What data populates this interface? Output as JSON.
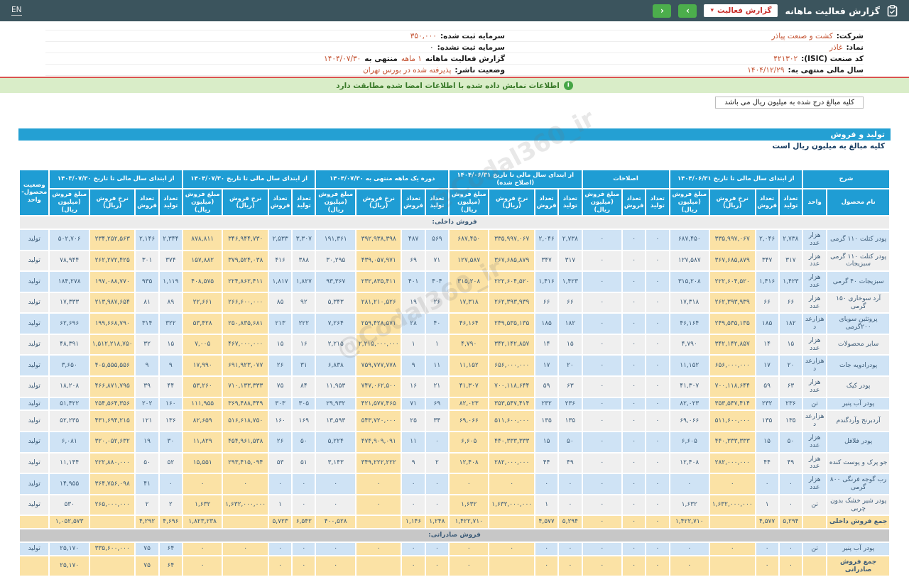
{
  "topbar": {
    "lang": "EN",
    "title": "گزارش فعالیت ماهانه",
    "report_button": "گزارش فعالیت",
    "caret": "▾",
    "nav_next": "›",
    "nav_prev": "‹"
  },
  "info": {
    "rows": [
      {
        "right": [
          [
            "شرکت:",
            "l"
          ],
          [
            "کشت و صنعت پیاذر",
            "v"
          ]
        ],
        "left": [
          [
            "سرمایه ثبت شده:",
            "l"
          ],
          [
            "۳۵۰,۰۰۰",
            "v"
          ]
        ]
      },
      {
        "right": [
          [
            "نماد:",
            "l"
          ],
          [
            "غاذر",
            "v"
          ]
        ],
        "left": [
          [
            "سرمایه ثبت نشده:",
            "l"
          ],
          [
            "۰",
            "d"
          ]
        ]
      },
      {
        "right": [
          [
            "کد صنعت (ISIC):",
            "l"
          ],
          [
            "۴۲۱۳۰۲",
            "v"
          ]
        ],
        "left": [
          [
            "گزارش فعالیت ماهانه",
            "l"
          ],
          [
            "۱ ماهه",
            "v"
          ],
          [
            "منتهی به",
            "l"
          ],
          [
            "۱۴۰۴/۰۷/۳۰",
            "v"
          ]
        ]
      },
      {
        "right": [
          [
            "سال مالی منتهی به:",
            "l"
          ],
          [
            "۱۴۰۴/۱۲/۲۹",
            "v"
          ]
        ],
        "left": [
          [
            "وضعیت ناشر:",
            "l"
          ],
          [
            "پذیرفته شده در بورس تهران",
            "v"
          ]
        ]
      }
    ]
  },
  "notice": {
    "text": "اطلاعات نمایش داده شده با اطلاعات امضا شده مطابقت دارد"
  },
  "amounts_note": "کلیه مبالغ درج شده به میلیون ریال می باشد",
  "section": {
    "title": "تولید و فروش",
    "subtitle": "کلیه مبالغ به میلیون ریال است"
  },
  "watermark": "@Codal360_ir",
  "colors": {
    "topbar": "#3b545d",
    "accent_blue": "#24a0d3",
    "accent_green": "#4cae4c",
    "value_red": "#c3502f",
    "stripe_blue": "#cfe3f5",
    "stripe_gray": "#efefef",
    "highlight_yellow": "#fbe2a5"
  },
  "table": {
    "col_groups": [
      {
        "label": "شرح",
        "subs": [
          "نام محصول",
          "واحد"
        ]
      },
      {
        "label": "از ابتدای سال مالی تا تاریخ ۱۴۰۴/۰۶/۳۱",
        "subs": [
          "تعداد تولید",
          "تعداد فروش",
          "نرخ فروش (ریال)",
          "مبلغ فروش (میلیون ریال)"
        ]
      },
      {
        "label": "اصلاحات",
        "subs": [
          "تعداد تولید",
          "تعداد فروش",
          "مبلغ فروش (میلیون ریال)"
        ]
      },
      {
        "label": "از ابتدای سال مالی تا تاریخ ۱۴۰۴/۰۶/۳۱ (اصلاح شده)",
        "subs": [
          "تعداد تولید",
          "تعداد فروش",
          "نرخ فروش (ریال)",
          "مبلغ فروش (میلیون ریال)"
        ]
      },
      {
        "label": "دوره یک ماهه منتهی به ۱۴۰۴/۰۷/۳۰",
        "subs": [
          "تعداد تولید",
          "تعداد فروش",
          "نرخ فروش (ریال)",
          "مبلغ فروش (میلیون ریال)"
        ]
      },
      {
        "label": "از ابتدای سال مالی تا تاریخ ۱۴۰۴/۰۷/۳۰",
        "subs": [
          "تعداد تولید",
          "تعداد فروش",
          "نرخ فروش (ریال)",
          "مبلغ فروش (میلیون ریال)"
        ]
      },
      {
        "label": "از ابتدای سال مالی تا تاریخ ۱۴۰۳/۰۷/۳۰",
        "subs": [
          "تعداد تولید",
          "تعداد فروش",
          "نرخ فروش (ریال)",
          "مبلغ فروش (میلیون ریال)"
        ]
      },
      {
        "label": "وضعیت محصول-واحد",
        "subs": []
      }
    ],
    "rows": [
      {
        "type": "category",
        "label": "فروش داخلی:",
        "variant": "light"
      },
      {
        "type": "item",
        "cells": [
          "پودر کتلت ۱۱۰ گرمی",
          "هزار عدد",
          "۲,۷۳۸",
          "۲,۰۴۶",
          "۳۳۵,۹۹۷,۰۶۷",
          "۶۸۷,۴۵۰",
          "۰",
          "۰",
          "۰",
          "۲,۷۳۸",
          "۲,۰۴۶",
          "۳۳۵,۹۹۷,۰۶۷",
          "۶۸۷,۴۵۰",
          "۵۶۹",
          "۴۸۷",
          "۳۹۲,۹۳۸,۳۹۸",
          "۱۹۱,۳۶۱",
          "۳,۳۰۷",
          "۲,۵۳۳",
          "۳۴۶,۹۴۴,۷۳۰",
          "۸۷۸,۸۱۱",
          "۲,۳۴۴",
          "۲,۱۴۶",
          "۲۳۴,۲۵۲,۵۶۳",
          "۵۰۲,۷۰۶",
          "تولید"
        ]
      },
      {
        "type": "item",
        "cells": [
          "پودر کتلت ۱۱۰ گرمی سبزیجات",
          "هزار عدد",
          "۳۱۷",
          "۳۴۷",
          "۳۶۷,۶۸۵,۸۷۹",
          "۱۲۷,۵۸۷",
          "۰",
          "۰",
          "۰",
          "۳۱۷",
          "۳۴۷",
          "۳۶۷,۶۸۵,۸۷۹",
          "۱۲۷,۵۸۷",
          "۷۱",
          "۶۹",
          "۴۳۹,۰۵۷,۹۷۱",
          "۳۰,۲۹۵",
          "۳۸۸",
          "۴۱۶",
          "۳۷۹,۵۲۴,۰۳۸",
          "۱۵۷,۸۸۲",
          "۳۷۴",
          "۳۰۱",
          "۲۶۲,۲۷۲,۴۲۵",
          "۷۸,۹۴۴",
          "تولید"
        ]
      },
      {
        "type": "item",
        "cells": [
          "سبزیجات ۴۰ گرمی",
          "هزار عدد",
          "۱,۴۲۳",
          "۱,۴۱۶",
          "۲۲۲,۶۰۴,۵۲۰",
          "۳۱۵,۲۰۸",
          "۰",
          "۰",
          "۰",
          "۱,۴۲۳",
          "۱,۴۱۶",
          "۲۲۲,۶۰۴,۵۲۰",
          "۳۱۵,۲۰۸",
          "۴۰۴",
          "۴۰۱",
          "۲۳۲,۸۳۵,۴۱۱",
          "۹۳,۳۶۷",
          "۱,۸۲۷",
          "۱,۸۱۷",
          "۲۲۴,۸۶۲,۴۱۱",
          "۴۰۸,۵۷۵",
          "۱,۱۱۹",
          "۹۳۵",
          "۱۹۷,۰۸۸,۷۷۰",
          "۱۸۴,۲۷۸",
          "تولید"
        ]
      },
      {
        "type": "item",
        "cells": [
          "آرد سوخاری ۱۵۰ گرمی",
          "هزار عدد",
          "۶۶",
          "۶۶",
          "۲۶۲,۳۹۳,۹۳۹",
          "۱۷,۳۱۸",
          "۰",
          "۰",
          "۰",
          "۶۶",
          "۶۶",
          "۲۶۲,۳۹۳,۹۳۹",
          "۱۷,۳۱۸",
          "۲۶",
          "۱۹",
          "۲۸۱,۲۱۰,۵۲۶",
          "۵,۳۴۳",
          "۹۲",
          "۸۵",
          "۲۶۶,۶۰۰,۰۰۰",
          "۲۲,۶۶۱",
          "۸۹",
          "۸۱",
          "۲۱۳,۹۸۷,۶۵۴",
          "۱۷,۳۳۳",
          "تولید"
        ]
      },
      {
        "type": "item",
        "cells": [
          "پروتئین سویای ۲۰۰گرمی",
          "هزارعدد",
          "۱۸۲",
          "۱۸۵",
          "۲۴۹,۵۳۵,۱۳۵",
          "۴۶,۱۶۴",
          "۰",
          "۰",
          "۰",
          "۱۸۲",
          "۱۸۵",
          "۲۴۹,۵۳۵,۱۳۵",
          "۴۶,۱۶۴",
          "۴۰",
          "۲۸",
          "۲۵۹,۴۲۸,۵۷۱",
          "۷,۲۶۴",
          "۲۲۲",
          "۲۱۳",
          "۲۵۰,۸۳۵,۶۸۱",
          "۵۳,۴۲۸",
          "۳۲۲",
          "۳۱۴",
          "۱۹۹,۶۶۸,۷۹۰",
          "۶۲,۶۹۶",
          "تولید"
        ]
      },
      {
        "type": "item",
        "cells": [
          "سایر محصولات",
          "هزار عدد",
          "۱۵",
          "۱۴",
          "۳۴۲,۱۴۲,۸۵۷",
          "۴,۷۹۰",
          "۰",
          "۰",
          "۰",
          "۱۵",
          "۱۴",
          "۳۴۲,۱۴۲,۸۵۷",
          "۴,۷۹۰",
          "۱",
          "۱",
          "۲,۲۱۵,۰۰۰,۰۰۰",
          "۲,۲۱۵",
          "۱۶",
          "۱۵",
          "۴۶۷,۰۰۰,۰۰۰",
          "۷,۰۰۵",
          "۱۵",
          "۳۲",
          "۱,۵۱۲,۲۱۸,۷۵۰",
          "۴۸,۳۹۱",
          "تولید"
        ]
      },
      {
        "type": "item",
        "cells": [
          "پودرادویه جات",
          "هزارعدد",
          "۲۰",
          "۱۷",
          "۶۵۶,۰۰۰,۰۰۰",
          "۱۱,۱۵۲",
          "۰",
          "۰",
          "۰",
          "۲۰",
          "۱۷",
          "۶۵۶,۰۰۰,۰۰۰",
          "۱۱,۱۵۲",
          "۱۱",
          "۹",
          "۷۵۹,۷۷۷,۷۷۸",
          "۶,۸۳۸",
          "۳۱",
          "۲۶",
          "۶۹۱,۹۲۳,۰۷۷",
          "۱۷,۹۹۰",
          "۹",
          "۹",
          "۴۰۵,۵۵۵,۵۵۶",
          "۳,۶۵۰",
          "تولید"
        ]
      },
      {
        "type": "item",
        "cells": [
          "پودر کیک",
          "هزار عدد",
          "۶۳",
          "۵۹",
          "۷۰۰,۱۱۸,۶۴۴",
          "۴۱,۳۰۷",
          "۰",
          "۰",
          "۰",
          "۶۳",
          "۵۹",
          "۷۰۰,۱۱۸,۶۴۴",
          "۴۱,۳۰۷",
          "۲۱",
          "۱۶",
          "۷۴۷,۰۶۲,۵۰۰",
          "۱۱,۹۵۳",
          "۸۴",
          "۷۵",
          "۷۱۰,۱۳۳,۳۳۳",
          "۵۳,۲۶۰",
          "۴۴",
          "۳۹",
          "۴۶۶,۸۷۱,۷۹۵",
          "۱۸,۲۰۸",
          "تولید"
        ]
      },
      {
        "type": "item",
        "cells": [
          "پودر آب پنیر",
          "تن",
          "۲۳۶",
          "۲۳۲",
          "۳۵۳,۵۴۷,۴۱۴",
          "۸۲,۰۲۳",
          "۰",
          "۰",
          "۰",
          "۲۳۶",
          "۲۳۲",
          "۳۵۳,۵۴۷,۴۱۴",
          "۸۲,۰۲۳",
          "۶۹",
          "۷۱",
          "۴۲۱,۵۷۷,۴۶۵",
          "۲۹,۹۳۲",
          "۳۰۵",
          "۳۰۳",
          "۳۶۹,۴۸۸,۴۴۹",
          "۱۱۱,۹۵۵",
          "۱۶۰",
          "۲۰۲",
          "۲۵۴,۵۶۴,۳۵۶",
          "۵۱,۴۲۲",
          "تولید"
        ]
      },
      {
        "type": "item",
        "cells": [
          "آردبرنج وآردگندم",
          "هزارعدد",
          "۱۳۵",
          "۱۳۵",
          "۵۱۱,۶۰۰,۰۰۰",
          "۶۹,۰۶۶",
          "۰",
          "۰",
          "۰",
          "۱۳۵",
          "۱۳۵",
          "۵۱۱,۶۰۰,۰۰۰",
          "۶۹,۰۶۶",
          "۳۴",
          "۲۵",
          "۵۴۳,۷۲۰,۰۰۰",
          "۱۳,۵۹۳",
          "۱۶۹",
          "۱۶۰",
          "۵۱۶,۶۱۸,۷۵۰",
          "۸۲,۶۵۹",
          "۱۳۶",
          "۱۲۱",
          "۴۳۱,۶۹۴,۲۱۵",
          "۵۲,۲۳۵",
          "تولید"
        ]
      },
      {
        "type": "item",
        "cells": [
          "پودر فلافل",
          "هزار عدد",
          "۵۰",
          "۱۵",
          "۴۴۰,۳۳۳,۳۳۳",
          "۶,۶۰۵",
          "۰",
          "۰",
          "۰",
          "۵۰",
          "۱۵",
          "۴۴۰,۳۳۳,۳۳۳",
          "۶,۶۰۵",
          "۰",
          "۱۱",
          "۴۷۴,۹۰۹,۰۹۱",
          "۵,۲۲۴",
          "۵۰",
          "۲۶",
          "۴۵۴,۹۶۱,۵۳۸",
          "۱۱,۸۲۹",
          "۳۰",
          "۱۹",
          "۳۲۰,۰۵۲,۶۳۲",
          "۶,۰۸۱",
          "تولید"
        ]
      },
      {
        "type": "item",
        "cells": [
          "جو پرک و پوست کنده",
          "هزار عدد",
          "۴۹",
          "۴۴",
          "۲۸۲,۰۰۰,۰۰۰",
          "۱۲,۴۰۸",
          "۰",
          "۰",
          "۰",
          "۴۹",
          "۴۴",
          "۲۸۲,۰۰۰,۰۰۰",
          "۱۲,۴۰۸",
          "۲",
          "۹",
          "۳۴۹,۲۲۲,۲۲۲",
          "۳,۱۴۳",
          "۵۱",
          "۵۳",
          "۲۹۳,۴۱۵,۰۹۴",
          "۱۵,۵۵۱",
          "۵۲",
          "۵۰",
          "۲۲۲,۸۸۰,۰۰۰",
          "۱۱,۱۴۴",
          "تولید"
        ]
      },
      {
        "type": "item",
        "cells": [
          "رب گوجه فرنگی ۸۰۰ گرمی",
          "هزار عدد",
          "۰",
          "۰",
          "۰",
          "۰",
          "۰",
          "۰",
          "۰",
          "۰",
          "۰",
          "۰",
          "۰",
          "۰",
          "۰",
          "۰",
          "۰",
          "۰",
          "۰",
          "۰",
          "۰",
          "۰",
          "۴۱",
          "۳۶۴,۷۵۶,۰۹۸",
          "۱۴,۹۵۵",
          "تولید"
        ]
      },
      {
        "type": "item",
        "cells": [
          "پودر شیر خشک بدون چربی",
          "تن",
          "۰",
          "۱",
          "۱,۶۳۲,۰۰۰,۰۰۰",
          "۱,۶۳۲",
          "۰",
          "۰",
          "۰",
          "۰",
          "۱",
          "۱,۶۳۲,۰۰۰,۰۰۰",
          "۱,۶۳۲",
          "۰",
          "۰",
          "۰",
          "۰",
          "۰",
          "۱",
          "۱,۶۳۲,۰۰۰,۰۰۰",
          "۱,۶۳۲",
          "۲",
          "۲",
          "۲۶۵,۰۰۰,۰۰۰",
          "۵۳۰",
          "تولید"
        ]
      },
      {
        "type": "total",
        "cells": [
          "جمع فروش داخلی",
          "",
          "۵,۲۹۴",
          "۴,۵۷۷",
          "",
          "۱,۴۲۲,۷۱۰",
          "۰",
          "۰",
          "۰",
          "۵,۲۹۴",
          "۴,۵۷۷",
          "",
          "۱,۴۲۲,۷۱۰",
          "۱,۲۴۸",
          "۱,۱۴۶",
          "",
          "۴۰۰,۵۲۸",
          "۶,۵۴۲",
          "۵,۷۲۳",
          "",
          "۱,۸۲۳,۲۳۸",
          "۴,۶۹۶",
          "۴,۲۹۲",
          "",
          "۱,۰۵۲,۵۷۳",
          ""
        ]
      },
      {
        "type": "category",
        "label": "فروش صادراتی:",
        "variant": "dark"
      },
      {
        "type": "item",
        "cells": [
          "پودر آب پنیر",
          "تن",
          "۰",
          "۰",
          "۰",
          "۰",
          "۰",
          "۰",
          "۰",
          "۰",
          "۰",
          "۰",
          "۰",
          "۰",
          "۰",
          "۰",
          "۰",
          "۰",
          "۰",
          "۰",
          "۰",
          "۶۴",
          "۷۵",
          "۳۳۵,۶۰۰,۰۰۰",
          "۲۵,۱۷۰",
          "تولید"
        ]
      },
      {
        "type": "total",
        "cells": [
          "جمع فروش صادراتی",
          "",
          "۰",
          "۰",
          "",
          "۰",
          "۰",
          "۰",
          "۰",
          "۰",
          "۰",
          "",
          "۰",
          "۰",
          "۰",
          "",
          "۰",
          "۰",
          "۰",
          "",
          "۰",
          "۶۴",
          "۷۵",
          "",
          "۲۵,۱۷۰",
          ""
        ]
      }
    ]
  }
}
